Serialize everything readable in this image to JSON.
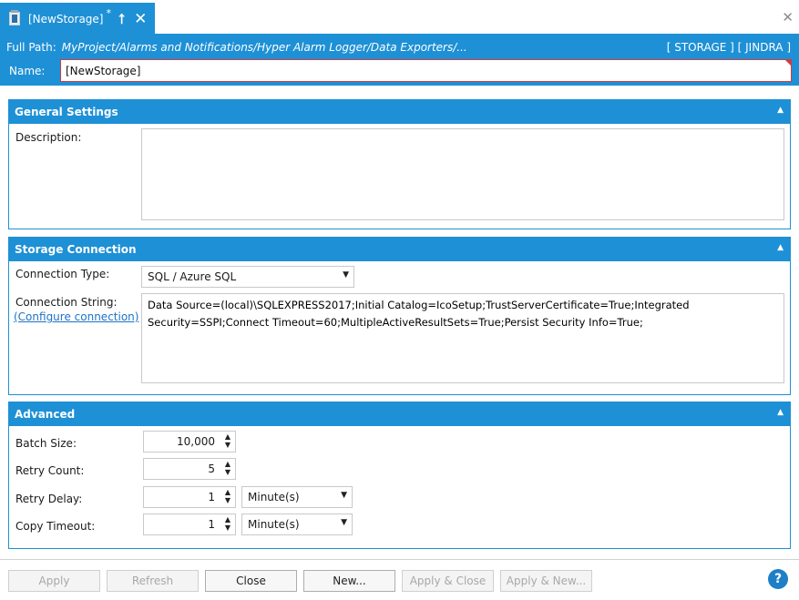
{
  "tab": {
    "title": "[NewStorage]",
    "modified_mark": "*",
    "pin_glyph": "⭡",
    "close_glyph": "✕"
  },
  "window": {
    "close_glyph": "✕"
  },
  "header": {
    "full_path_label": "Full Path:",
    "full_path": "MyProject/Alarms and Notifications/Hyper Alarm Logger/Data Exporters/...",
    "server": "[ STORAGE ] [ JINDRA ]",
    "name_label": "Name:",
    "name_value": "[NewStorage]"
  },
  "general": {
    "title": "General Settings",
    "description_label": "Description:",
    "description_value": ""
  },
  "storage": {
    "title": "Storage Connection",
    "connection_type_label": "Connection Type:",
    "connection_type_value": "SQL / Azure SQL",
    "connection_string_label": "Connection String:",
    "configure_link": "(Configure connection)",
    "connection_string_value": "Data Source=(local)\\SQLEXPRESS2017;Initial Catalog=IcoSetup;TrustServerCertificate=True;Integrated Security=SSPI;Connect Timeout=60;MultipleActiveResultSets=True;Persist Security Info=True;"
  },
  "advanced": {
    "title": "Advanced",
    "batch_size_label": "Batch Size:",
    "batch_size_value": "10,000",
    "retry_count_label": "Retry Count:",
    "retry_count_value": "5",
    "retry_delay_label": "Retry Delay:",
    "retry_delay_value": "1",
    "retry_delay_unit": "Minute(s)",
    "copy_timeout_label": "Copy Timeout:",
    "copy_timeout_value": "1",
    "copy_timeout_unit": "Minute(s)"
  },
  "footer": {
    "apply": "Apply",
    "refresh": "Refresh",
    "close": "Close",
    "new": "New...",
    "apply_close": "Apply & Close",
    "apply_new": "Apply & New...",
    "help": "?"
  },
  "colors": {
    "accent": "#1e90d6",
    "error_border": "#d43b3b",
    "link": "#1e72c6"
  }
}
